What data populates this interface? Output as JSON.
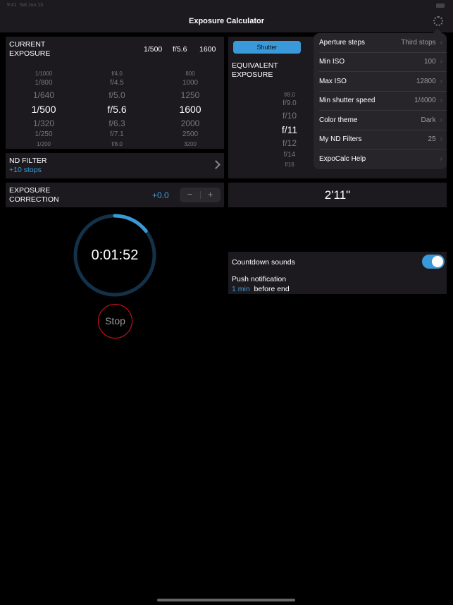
{
  "status_bar": {
    "time": "9:41",
    "date": "Sat Jun 13"
  },
  "nav": {
    "title": "Exposure Calculator",
    "settings_icon": "gear-icon"
  },
  "current_exposure": {
    "label_line1": "CURRENT",
    "label_line2": "EXPOSURE",
    "shutter": "1/500",
    "aperture": "f/5.6",
    "iso": "1600",
    "shutter_wheel": [
      "1/1000",
      "1/800",
      "1/640",
      "1/500",
      "1/320",
      "1/250",
      "1/200"
    ],
    "aperture_wheel": [
      "f/4.0",
      "f/4.5",
      "f/5.0",
      "f/5.6",
      "f/6.3",
      "f/7.1",
      "f/8.0"
    ],
    "iso_wheel": [
      "800",
      "1000",
      "1250",
      "1600",
      "2000",
      "2500",
      "3200"
    ]
  },
  "nd_filter": {
    "label": "ND FILTER",
    "value": "+10 stops"
  },
  "exposure_correction": {
    "label_line1": "EXPOSURE",
    "label_line2": "CORRECTION",
    "value": "+0.0",
    "minus": "−",
    "plus": "+"
  },
  "equivalent": {
    "segment_selected": "Shutter",
    "label_line1": "EQUIVALENT",
    "label_line2": "EXPOSURE",
    "aperture_wheel": [
      "f/8.0",
      "f/9.0",
      "f/10",
      "f/11",
      "f/12",
      "f/14",
      "f/16"
    ],
    "result": "2'11\""
  },
  "timer": {
    "time": "0:01:52",
    "progress": 0.145,
    "stop_label": "Stop",
    "accent": "#3a9ad9",
    "stop_color": "#e0141e"
  },
  "notifications": {
    "countdown_sounds": "Countdown sounds",
    "countdown_on": true,
    "push_label": "Push notification",
    "push_value": "1 min",
    "push_suffix": "before end"
  },
  "settings_menu": [
    {
      "label": "Aperture steps",
      "value": "Third stops"
    },
    {
      "label": "Min ISO",
      "value": "100"
    },
    {
      "label": "Max ISO",
      "value": "12800"
    },
    {
      "label": "Min shutter speed",
      "value": "1/4000"
    },
    {
      "label": "Color theme",
      "value": "Dark"
    },
    {
      "label": "My ND Filters",
      "value": "25"
    },
    {
      "label": "ExpoCalc Help",
      "value": ""
    }
  ]
}
